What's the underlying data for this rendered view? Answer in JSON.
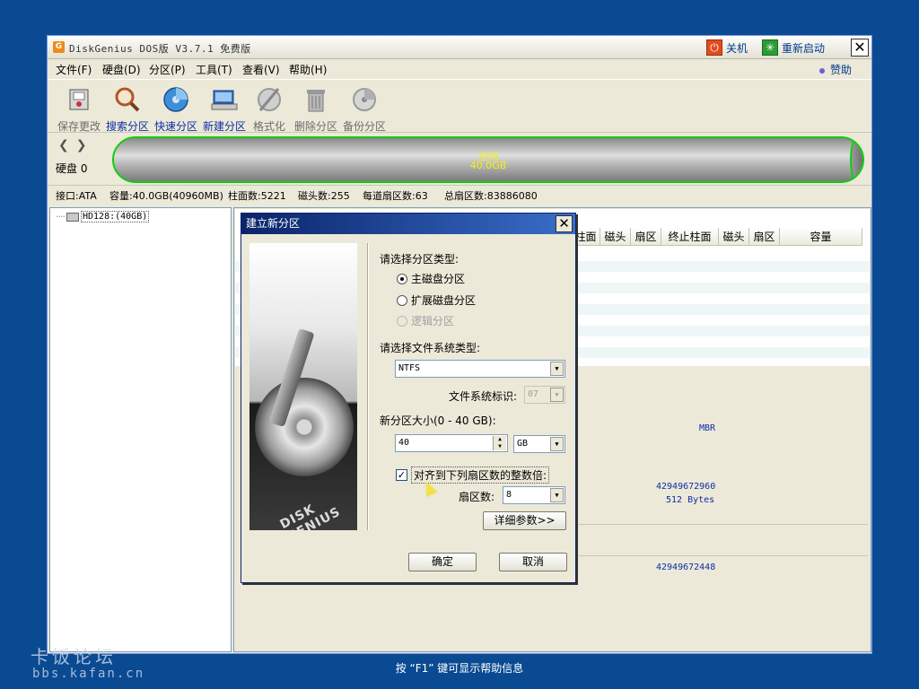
{
  "window": {
    "title": "DiskGenius DOS版 V3.7.1 免费版",
    "shutdown_label": "关机",
    "restart_label": "重新启动",
    "close_glyph": "✕",
    "donate_label": "赞助"
  },
  "menu": [
    "文件(F)",
    "硬盘(D)",
    "分区(P)",
    "工具(T)",
    "查看(V)",
    "帮助(H)"
  ],
  "toolbar": [
    {
      "label": "保存更改",
      "icon": "save-icon",
      "state": "disabled"
    },
    {
      "label": "搜索分区",
      "icon": "search-partition-icon",
      "state": "enabled"
    },
    {
      "label": "快速分区",
      "icon": "quick-partition-icon",
      "state": "enabled"
    },
    {
      "label": "新建分区",
      "icon": "new-partition-icon",
      "state": "enabled"
    },
    {
      "label": "格式化",
      "icon": "format-icon",
      "state": "disabled"
    },
    {
      "label": "删除分区",
      "icon": "delete-partition-icon",
      "state": "disabled"
    },
    {
      "label": "备份分区",
      "icon": "backup-partition-icon",
      "state": "disabled"
    }
  ],
  "disk": {
    "label": "硬盘 0",
    "free_label": "空闲",
    "free_size": "40.0GB"
  },
  "info": {
    "interface": "接口:ATA",
    "capacity": "容量:40.0GB(40960MB)",
    "cylinders": "柱面数:5221",
    "heads": "磁头数:255",
    "sectors_per_track": "每道扇区数:63",
    "total_sectors": "总扇区数:83886080"
  },
  "tree": {
    "node": "HD128:(40GB)"
  },
  "table": {
    "columns": [
      "柱面",
      "磁头",
      "扇区",
      "终止柱面",
      "磁头",
      "扇区",
      "容量"
    ],
    "partition_style": "MBR",
    "value1": "42949672960",
    "value2": "512 Bytes",
    "value3": "42949672448"
  },
  "dialog": {
    "title": "建立新分区",
    "close_glyph": "✕",
    "partition_type_label": "请选择分区类型:",
    "primary_label": "主磁盘分区",
    "extended_label": "扩展磁盘分区",
    "logical_label": "逻辑分区",
    "fs_type_label": "请选择文件系统类型:",
    "fs_type_value": "NTFS",
    "fs_id_label": "文件系统标识:",
    "fs_id_value": "07",
    "size_label": "新分区大小(0 - 40 GB):",
    "size_value": "40",
    "size_unit": "GB",
    "align_label": "对齐到下列扇区数的整数倍:",
    "align_checked": true,
    "sectors_label": "扇区数:",
    "sectors_value": "8",
    "details_button": "详细参数>>",
    "ok_button": "确定",
    "cancel_button": "取消",
    "image_brand": "DISK GENIUS"
  },
  "status_bar": "按 “F1” 键可显示帮助信息",
  "watermark": {
    "title": "卡饭论坛",
    "url": "bbs.kafan.cn"
  },
  "colors": {
    "desktop": "#0a4a93",
    "window_bg": "#ece9d8",
    "disk_border": "#11cc11",
    "disk_text": "#f5f10a",
    "dialog_title": "#0a246a",
    "link_blue": "#0c2ca8"
  }
}
